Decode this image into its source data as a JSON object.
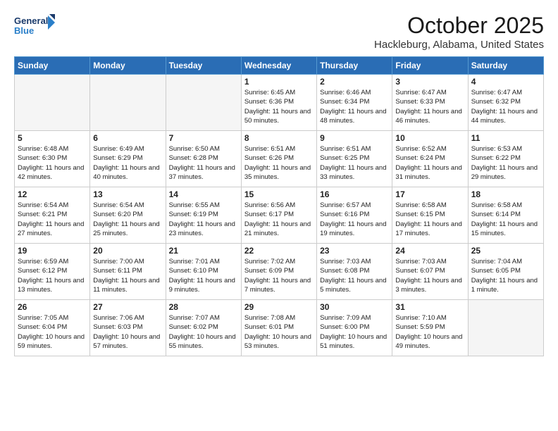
{
  "logo": {
    "line1": "General",
    "line2": "Blue"
  },
  "title": "October 2025",
  "location": "Hackleburg, Alabama, United States",
  "days_of_week": [
    "Sunday",
    "Monday",
    "Tuesday",
    "Wednesday",
    "Thursday",
    "Friday",
    "Saturday"
  ],
  "weeks": [
    [
      {
        "day": "",
        "info": ""
      },
      {
        "day": "",
        "info": ""
      },
      {
        "day": "",
        "info": ""
      },
      {
        "day": "1",
        "info": "Sunrise: 6:45 AM\nSunset: 6:36 PM\nDaylight: 11 hours\nand 50 minutes."
      },
      {
        "day": "2",
        "info": "Sunrise: 6:46 AM\nSunset: 6:34 PM\nDaylight: 11 hours\nand 48 minutes."
      },
      {
        "day": "3",
        "info": "Sunrise: 6:47 AM\nSunset: 6:33 PM\nDaylight: 11 hours\nand 46 minutes."
      },
      {
        "day": "4",
        "info": "Sunrise: 6:47 AM\nSunset: 6:32 PM\nDaylight: 11 hours\nand 44 minutes."
      }
    ],
    [
      {
        "day": "5",
        "info": "Sunrise: 6:48 AM\nSunset: 6:30 PM\nDaylight: 11 hours\nand 42 minutes."
      },
      {
        "day": "6",
        "info": "Sunrise: 6:49 AM\nSunset: 6:29 PM\nDaylight: 11 hours\nand 40 minutes."
      },
      {
        "day": "7",
        "info": "Sunrise: 6:50 AM\nSunset: 6:28 PM\nDaylight: 11 hours\nand 37 minutes."
      },
      {
        "day": "8",
        "info": "Sunrise: 6:51 AM\nSunset: 6:26 PM\nDaylight: 11 hours\nand 35 minutes."
      },
      {
        "day": "9",
        "info": "Sunrise: 6:51 AM\nSunset: 6:25 PM\nDaylight: 11 hours\nand 33 minutes."
      },
      {
        "day": "10",
        "info": "Sunrise: 6:52 AM\nSunset: 6:24 PM\nDaylight: 11 hours\nand 31 minutes."
      },
      {
        "day": "11",
        "info": "Sunrise: 6:53 AM\nSunset: 6:22 PM\nDaylight: 11 hours\nand 29 minutes."
      }
    ],
    [
      {
        "day": "12",
        "info": "Sunrise: 6:54 AM\nSunset: 6:21 PM\nDaylight: 11 hours\nand 27 minutes."
      },
      {
        "day": "13",
        "info": "Sunrise: 6:54 AM\nSunset: 6:20 PM\nDaylight: 11 hours\nand 25 minutes."
      },
      {
        "day": "14",
        "info": "Sunrise: 6:55 AM\nSunset: 6:19 PM\nDaylight: 11 hours\nand 23 minutes."
      },
      {
        "day": "15",
        "info": "Sunrise: 6:56 AM\nSunset: 6:17 PM\nDaylight: 11 hours\nand 21 minutes."
      },
      {
        "day": "16",
        "info": "Sunrise: 6:57 AM\nSunset: 6:16 PM\nDaylight: 11 hours\nand 19 minutes."
      },
      {
        "day": "17",
        "info": "Sunrise: 6:58 AM\nSunset: 6:15 PM\nDaylight: 11 hours\nand 17 minutes."
      },
      {
        "day": "18",
        "info": "Sunrise: 6:58 AM\nSunset: 6:14 PM\nDaylight: 11 hours\nand 15 minutes."
      }
    ],
    [
      {
        "day": "19",
        "info": "Sunrise: 6:59 AM\nSunset: 6:12 PM\nDaylight: 11 hours\nand 13 minutes."
      },
      {
        "day": "20",
        "info": "Sunrise: 7:00 AM\nSunset: 6:11 PM\nDaylight: 11 hours\nand 11 minutes."
      },
      {
        "day": "21",
        "info": "Sunrise: 7:01 AM\nSunset: 6:10 PM\nDaylight: 11 hours\nand 9 minutes."
      },
      {
        "day": "22",
        "info": "Sunrise: 7:02 AM\nSunset: 6:09 PM\nDaylight: 11 hours\nand 7 minutes."
      },
      {
        "day": "23",
        "info": "Sunrise: 7:03 AM\nSunset: 6:08 PM\nDaylight: 11 hours\nand 5 minutes."
      },
      {
        "day": "24",
        "info": "Sunrise: 7:03 AM\nSunset: 6:07 PM\nDaylight: 11 hours\nand 3 minutes."
      },
      {
        "day": "25",
        "info": "Sunrise: 7:04 AM\nSunset: 6:05 PM\nDaylight: 11 hours\nand 1 minute."
      }
    ],
    [
      {
        "day": "26",
        "info": "Sunrise: 7:05 AM\nSunset: 6:04 PM\nDaylight: 10 hours\nand 59 minutes."
      },
      {
        "day": "27",
        "info": "Sunrise: 7:06 AM\nSunset: 6:03 PM\nDaylight: 10 hours\nand 57 minutes."
      },
      {
        "day": "28",
        "info": "Sunrise: 7:07 AM\nSunset: 6:02 PM\nDaylight: 10 hours\nand 55 minutes."
      },
      {
        "day": "29",
        "info": "Sunrise: 7:08 AM\nSunset: 6:01 PM\nDaylight: 10 hours\nand 53 minutes."
      },
      {
        "day": "30",
        "info": "Sunrise: 7:09 AM\nSunset: 6:00 PM\nDaylight: 10 hours\nand 51 minutes."
      },
      {
        "day": "31",
        "info": "Sunrise: 7:10 AM\nSunset: 5:59 PM\nDaylight: 10 hours\nand 49 minutes."
      },
      {
        "day": "",
        "info": ""
      }
    ]
  ]
}
